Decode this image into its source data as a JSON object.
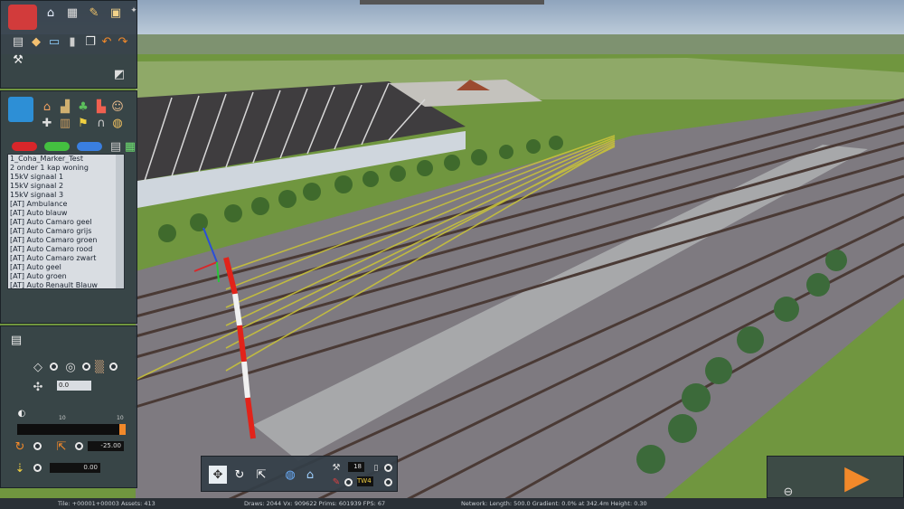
{
  "toolbar_icons": [
    "toolbox-icon",
    "home-icon",
    "grid-icon",
    "paintbrush-icon",
    "tram-icon"
  ],
  "edit_tools": [
    "page-icon",
    "cube-icon",
    "monitor-icon",
    "trash-icon",
    "copy-icon",
    "paste-icon",
    "undo-icon",
    "redo-icon",
    "measure-icon",
    "bucket-icon"
  ],
  "category_icons": [
    "house-icon",
    "scenery-icon",
    "tree-icon",
    "train-icon",
    "person-icon",
    "junction-icon",
    "building-icon",
    "flag-icon",
    "bridge-icon",
    "bag-icon"
  ],
  "asset_list": {
    "items": [
      "1_Coha_Marker_Test",
      "2 onder 1 kap woning",
      "15kV signaal 1",
      "15kV signaal 2",
      "15kV signaal 3",
      "[AT] Ambulance",
      "[AT] Auto blauw",
      "[AT] Auto Camaro geel",
      "[AT] Auto Camaro grijs",
      "[AT] Auto Camaro groen",
      "[AT] Auto Camaro rood",
      "[AT] Auto Camaro zwart",
      "[AT] Auto geel",
      "[AT] Auto groen",
      "[AT] Auto Renault Blauw"
    ]
  },
  "placement": {
    "offset_value": "0.0",
    "slider_min": "10",
    "slider_max": "10",
    "slider_fill": 0.95,
    "rotation_value": "-25.00",
    "height_value": "0.00"
  },
  "bottom_toolbar": {
    "height_value": "18",
    "track_value": "TW4"
  },
  "status": {
    "tile": "Tile: +00001+00003  Assets: 413",
    "stats": "Draws: 2044  Vx: 909622  Prims: 601939  FPS: 67",
    "network": "Network:  Length: 500.0  Gradient: 0.0% at 342.4m  Height:   0.30"
  },
  "colors": {
    "panel": "#343e48",
    "accent_orange": "#f2892a",
    "grass": "#6f9a3e",
    "track_yellow": "#c8c23a"
  }
}
